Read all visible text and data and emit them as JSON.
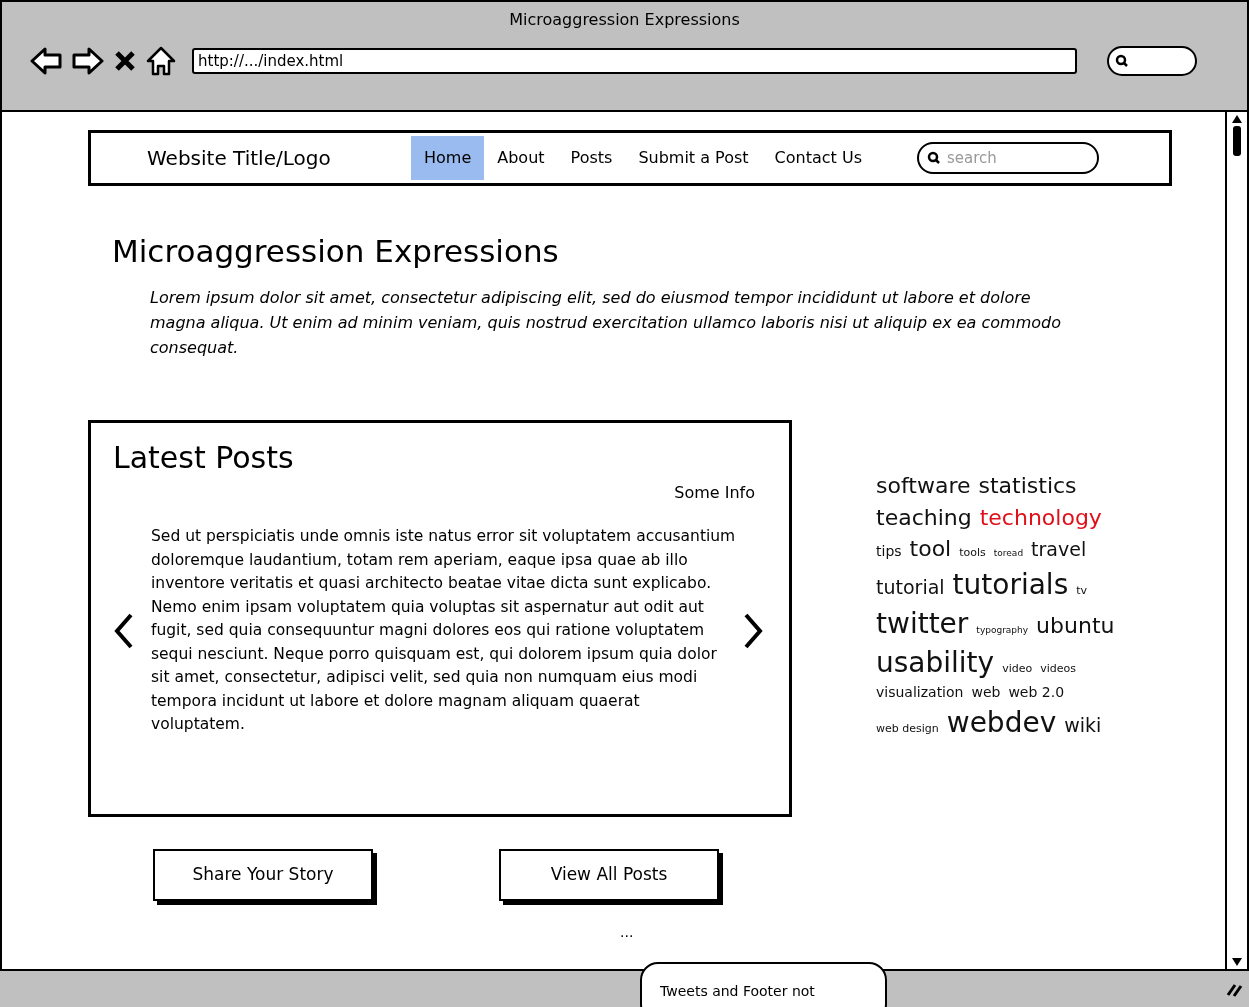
{
  "window": {
    "title": "Microaggression Expressions",
    "url": "http://.../index.html"
  },
  "nav": {
    "logo": "Website Title/Logo",
    "items": [
      {
        "label": "Home",
        "selected": true
      },
      {
        "label": "About",
        "selected": false
      },
      {
        "label": "Posts",
        "selected": false
      },
      {
        "label": "Submit a Post",
        "selected": false
      },
      {
        "label": "Contact Us",
        "selected": false
      }
    ],
    "search": {
      "placeholder": "search"
    }
  },
  "heading": "Microaggression Expressions",
  "intro": "Lorem ipsum dolor sit amet, consectetur adipiscing elit, sed do eiusmod tempor incididunt ut labore et dolore magna aliqua. Ut enim ad minim veniam, quis nostrud exercitation ullamco laboris nisi ut aliquip ex ea commodo consequat.",
  "latest_posts": {
    "title": "Latest Posts",
    "info": "Some Info",
    "text": "Sed ut perspiciatis unde omnis iste natus error sit voluptatem accusantium doloremque laudantium, totam rem aperiam, eaque ipsa quae ab illo inventore veritatis et quasi architecto beatae vitae dicta sunt explicabo. Nemo enim ipsam voluptatem quia voluptas sit aspernatur aut odit aut fugit, sed quia consequuntur magni dolores eos qui ratione voluptatem sequi nesciunt. Neque porro quisquam est, qui dolorem ipsum quia dolor sit amet, consectetur, adipisci velit, sed quia non numquam eius modi tempora incidunt ut labore et dolore magnam aliquam quaerat voluptatem."
  },
  "tag_lines": [
    [
      {
        "label": "software",
        "kind": "l",
        "highlighted": false
      },
      {
        "label": "statistics",
        "kind": "l",
        "highlighted": false
      }
    ],
    [
      {
        "label": "teaching",
        "kind": "l",
        "highlighted": false
      },
      {
        "label": "technology",
        "kind": "l",
        "highlighted": true
      }
    ],
    [
      {
        "label": "tips",
        "kind": "s",
        "highlighted": false
      },
      {
        "label": "tool",
        "kind": "l",
        "highlighted": false
      },
      {
        "label": "tools",
        "kind": "xs",
        "highlighted": false
      },
      {
        "label": "toread",
        "kind": "xxs",
        "highlighted": false
      },
      {
        "label": "travel",
        "kind": "m",
        "highlighted": false
      }
    ],
    [
      {
        "label": "tutorial",
        "kind": "m",
        "highlighted": false
      },
      {
        "label": "tutorials",
        "kind": "xl",
        "highlighted": false
      },
      {
        "label": "tv",
        "kind": "xs",
        "highlighted": false
      }
    ],
    [
      {
        "label": "twitter",
        "kind": "xl",
        "highlighted": false
      },
      {
        "label": "typography",
        "kind": "xxs",
        "highlighted": false
      },
      {
        "label": "ubuntu",
        "kind": "l",
        "highlighted": false
      }
    ],
    [
      {
        "label": "usability",
        "kind": "xl",
        "highlighted": false
      },
      {
        "label": "video",
        "kind": "xs",
        "highlighted": false
      },
      {
        "label": "videos",
        "kind": "xs",
        "highlighted": false
      }
    ],
    [
      {
        "label": "visualization",
        "kind": "s",
        "highlighted": false
      },
      {
        "label": "web",
        "kind": "s",
        "highlighted": false
      },
      {
        "label": "web 2.0",
        "kind": "s",
        "highlighted": false
      }
    ],
    [
      {
        "label": "web design",
        "kind": "xs",
        "highlighted": false
      },
      {
        "label": "webdev",
        "kind": "xl",
        "highlighted": false
      },
      {
        "label": "wiki",
        "kind": "m",
        "highlighted": false
      }
    ]
  ],
  "buttons": [
    "Share Your Story",
    "View All Posts"
  ],
  "more": "...",
  "callout": "Tweets and Footer not"
}
